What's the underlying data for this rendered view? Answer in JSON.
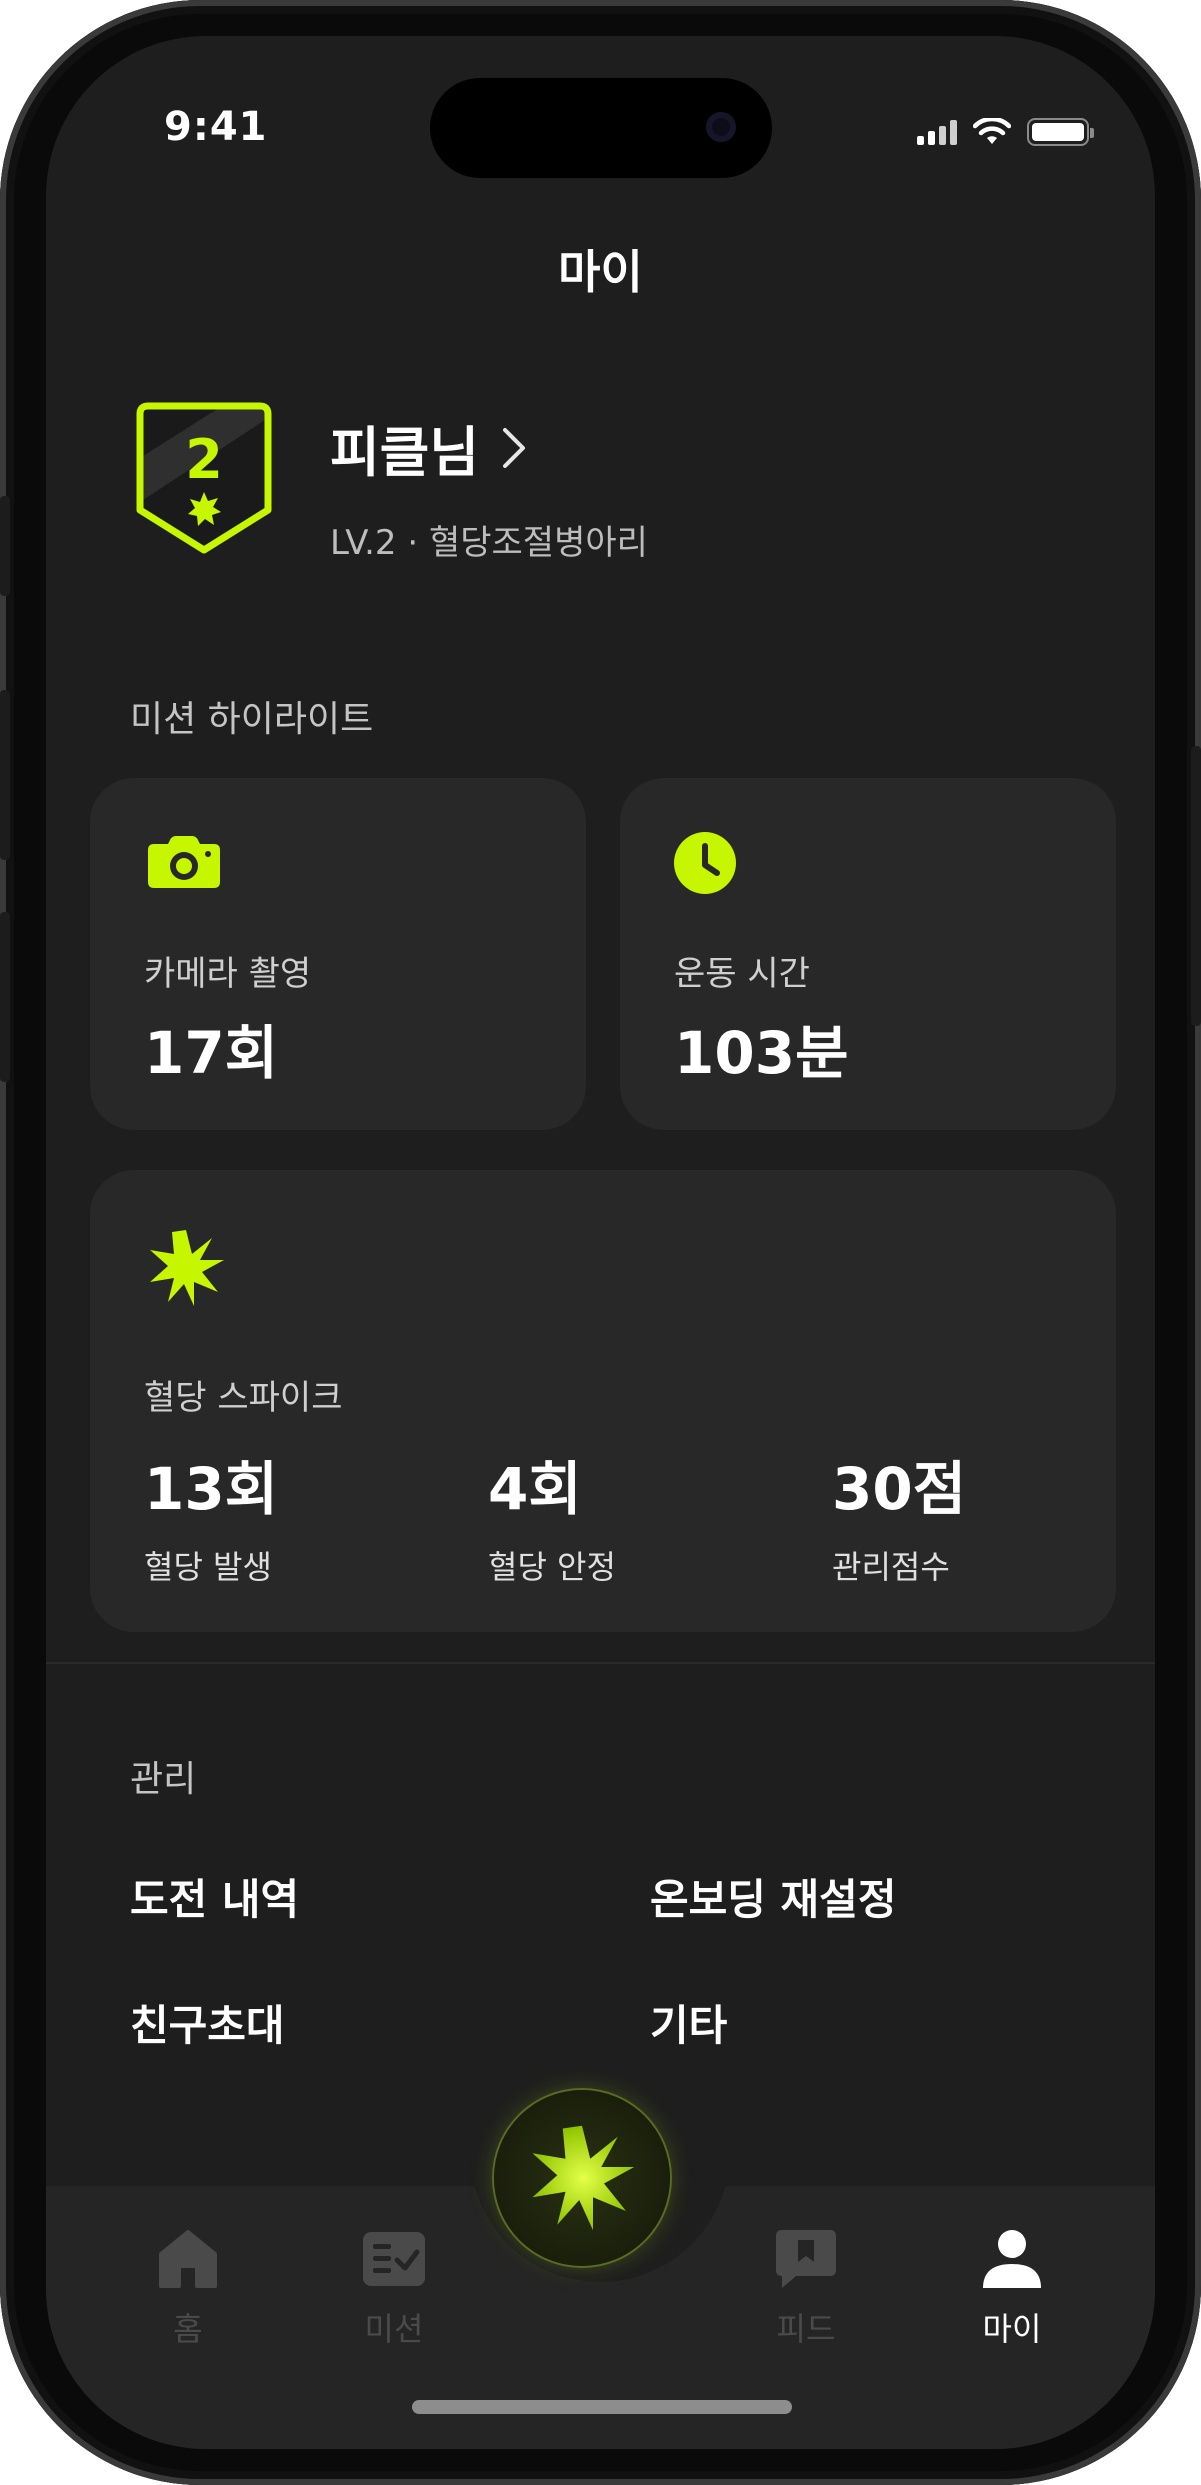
{
  "status": {
    "time": "9:41"
  },
  "header": {
    "title": "마이"
  },
  "profile": {
    "level_number": "2",
    "name": "피클님",
    "subtitle": "LV.2 · 혈당조절병아리"
  },
  "highlights": {
    "section_label": "미션 하이라이트",
    "camera": {
      "icon": "camera-icon",
      "label": "카메라 촬영",
      "value": "17회"
    },
    "exercise": {
      "icon": "clock-icon",
      "label": "운동 시간",
      "value": "103분"
    }
  },
  "spike": {
    "icon": "spike-star-icon",
    "label": "혈당 스파이크",
    "stats": [
      {
        "value": "13회",
        "label": "혈당 발생"
      },
      {
        "value": "4회",
        "label": "혈당 안정"
      },
      {
        "value": "30점",
        "label": "관리점수"
      }
    ]
  },
  "manage": {
    "section_label": "관리",
    "items": [
      "도전 내역",
      "온보딩 재설정",
      "친구초대",
      "기타"
    ]
  },
  "tabbar": {
    "tabs": [
      {
        "label": "홈",
        "icon": "home-icon",
        "active": false
      },
      {
        "label": "미션",
        "icon": "mission-checklist-icon",
        "active": false
      },
      {
        "label": "피드",
        "icon": "feed-bookmark-icon",
        "active": false
      },
      {
        "label": "마이",
        "icon": "person-icon",
        "active": true
      }
    ],
    "center_icon": "spike-star-icon"
  },
  "colors": {
    "accent": "#C6F600",
    "background": "#1E1E1E",
    "card": "#282828",
    "tab_inactive": "#4A4A4A"
  }
}
